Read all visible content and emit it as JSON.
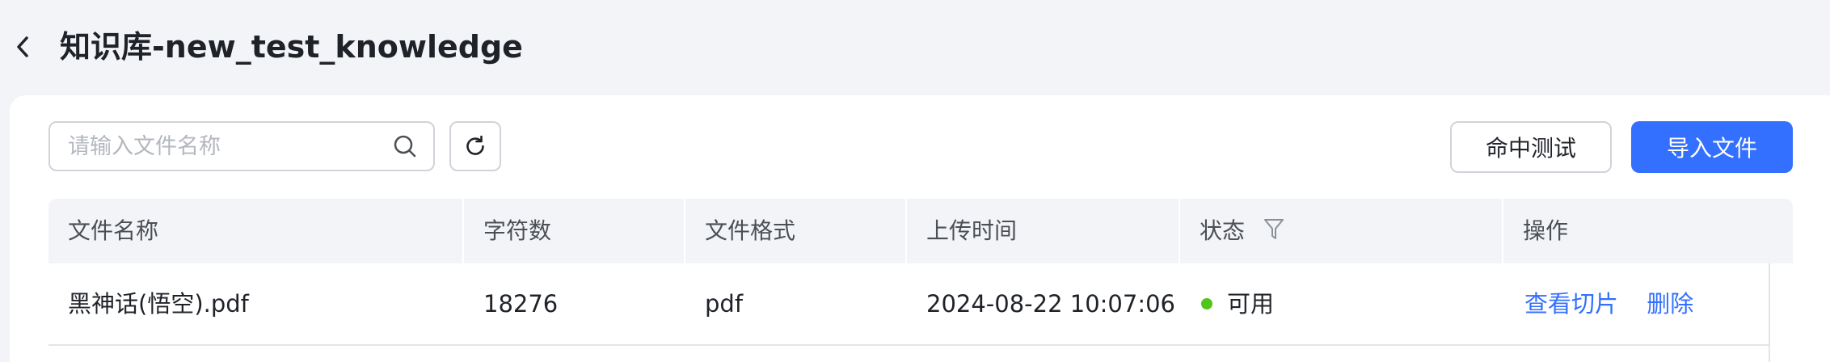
{
  "header": {
    "title": "知识库-new_test_knowledge"
  },
  "toolbar": {
    "search_placeholder": "请输入文件名称",
    "search_value": "",
    "hit_test_label": "命中测试",
    "import_label": "导入文件"
  },
  "table": {
    "columns": [
      "文件名称",
      "字符数",
      "文件格式",
      "上传时间",
      "状态",
      "操作"
    ],
    "rows": [
      {
        "name": "黑神话(悟空).pdf",
        "chars": "18276",
        "format": "pdf",
        "uploaded": "2024-08-22 10:07:06",
        "status": "可用",
        "actions": [
          "查看切片",
          "删除"
        ]
      }
    ]
  },
  "colors": {
    "primary": "#3370ff",
    "status_ok": "#52c41a",
    "background": "#f3f4f7"
  },
  "icons": {
    "back": "chevron-left-icon",
    "search": "search-icon",
    "refresh": "refresh-icon",
    "filter": "filter-icon"
  }
}
